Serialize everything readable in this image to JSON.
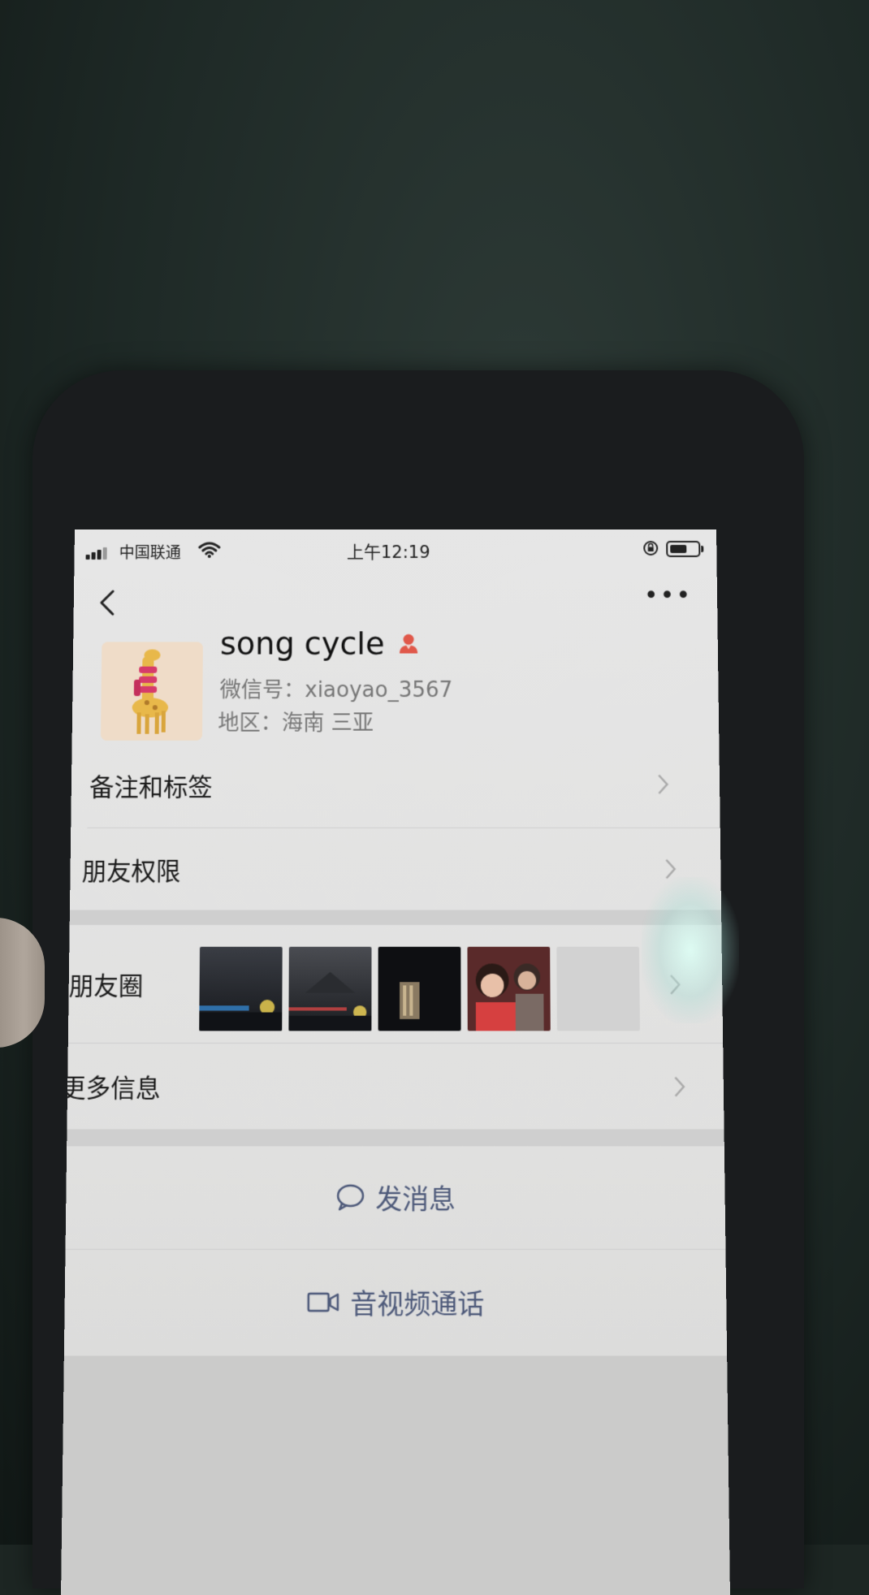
{
  "status_bar": {
    "carrier": "中国联通",
    "time": "上午12:19"
  },
  "nav": {
    "more_label": "•••"
  },
  "profile": {
    "name": "song cycle",
    "wechat_id": "微信号：xiaoyao_3567",
    "region": "地区：海南 三亚"
  },
  "menu": {
    "remark_tags": "备注和标签",
    "friend_permissions": "朋友权限",
    "moments": "朋友圈",
    "more_info": "更多信息"
  },
  "actions": {
    "send_message": "发消息",
    "video_call": "音视频通话"
  },
  "colors": {
    "action_text": "#4e5a7a",
    "female_icon": "#e0584a",
    "list_text": "#1a1a1a",
    "secondary_text": "#777777"
  }
}
